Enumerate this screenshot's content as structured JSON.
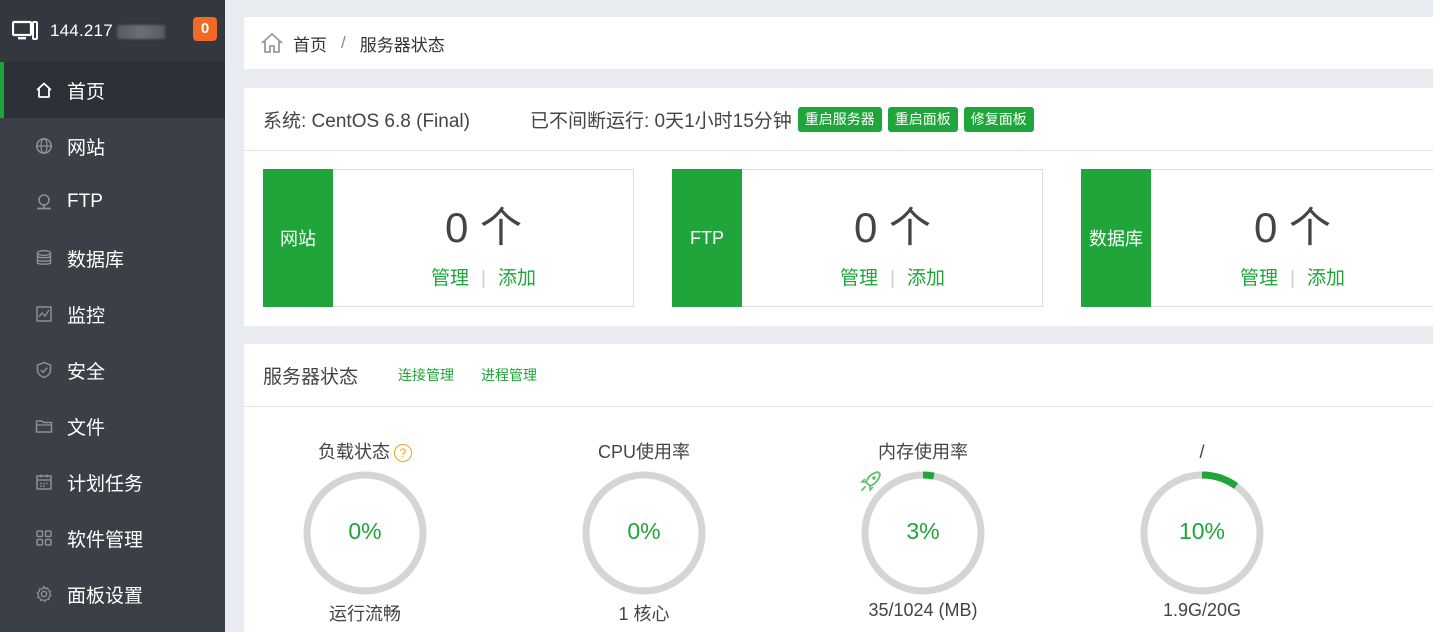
{
  "header": {
    "ip": "144.217",
    "badge": "0"
  },
  "sidebar": {
    "items": [
      {
        "label": "首页",
        "icon": "home-icon"
      },
      {
        "label": "网站",
        "icon": "globe-icon"
      },
      {
        "label": "FTP",
        "icon": "ftp-icon"
      },
      {
        "label": "数据库",
        "icon": "database-icon"
      },
      {
        "label": "监控",
        "icon": "monitor-chart-icon"
      },
      {
        "label": "安全",
        "icon": "shield-icon"
      },
      {
        "label": "文件",
        "icon": "folder-icon"
      },
      {
        "label": "计划任务",
        "icon": "calendar-icon"
      },
      {
        "label": "软件管理",
        "icon": "grid-icon"
      },
      {
        "label": "面板设置",
        "icon": "gear-icon"
      }
    ],
    "active": "首页"
  },
  "breadcrumb": {
    "home": "首页",
    "separator": "/",
    "current": "服务器状态"
  },
  "system": {
    "os_label": "系统: CentOS 6.8 (Final)",
    "uptime_label": "已不间断运行: 0天1小时15分钟",
    "buttons": {
      "restart_server": "重启服务器",
      "restart_panel": "重启面板",
      "repair_panel": "修复面板"
    }
  },
  "cards": [
    {
      "tag": "网站",
      "count": "0 个",
      "manage": "管理",
      "add": "添加"
    },
    {
      "tag": "FTP",
      "count": "0 个",
      "manage": "管理",
      "add": "添加"
    },
    {
      "tag": "数据库",
      "count": "0 个",
      "manage": "管理",
      "add": "添加"
    }
  ],
  "status": {
    "title": "服务器状态",
    "links": {
      "connections": "连接管理",
      "processes": "进程管理"
    },
    "help": "?",
    "gauges": [
      {
        "title": "负载状态",
        "value": "0%",
        "percent": 0,
        "sub": "运行流畅"
      },
      {
        "title": "CPU使用率",
        "value": "0%",
        "percent": 0,
        "sub": "1 核心"
      },
      {
        "title": "内存使用率",
        "value": "3%",
        "percent": 3,
        "sub": "35/1024 (MB)"
      },
      {
        "title": "/",
        "value": "10%",
        "percent": 10,
        "sub": "1.9G/20G"
      }
    ]
  },
  "colors": {
    "accent": "#20a53a",
    "sidebar": "#3a4046",
    "badge": "#f06a24",
    "ring_track": "#d5d5d5"
  }
}
